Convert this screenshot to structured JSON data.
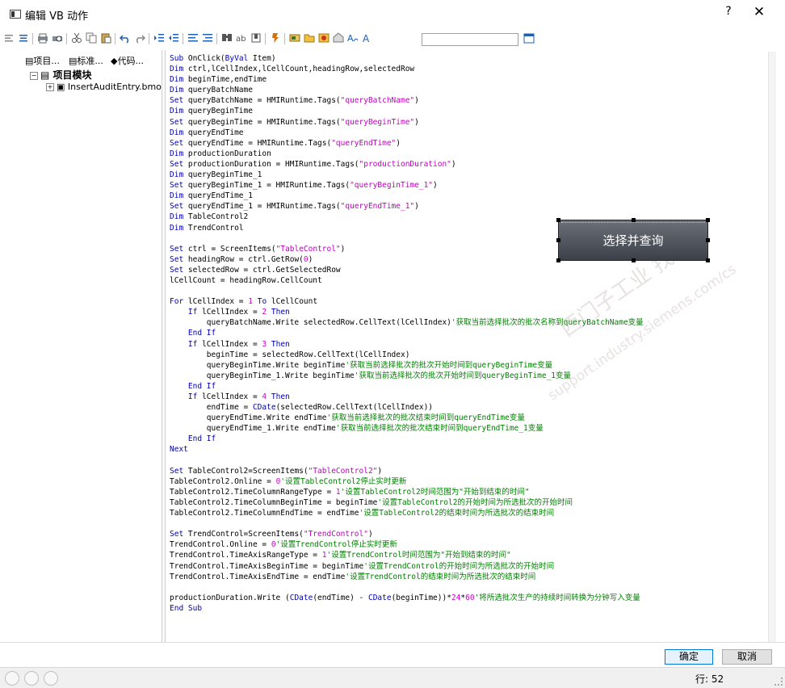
{
  "window": {
    "title": "编辑 VB 动作",
    "help_label": "?",
    "close_label": "✕"
  },
  "toolbar": {
    "icons": [
      "align-left-icon",
      "align-center-icon",
      "print-icon",
      "print-preview-icon",
      "cut-icon",
      "copy-icon",
      "paste-icon",
      "undo-icon",
      "redo-icon",
      "indent-icon",
      "outdent-icon",
      "comment-icon",
      "uncomment-icon",
      "find-icon",
      "replace-icon",
      "bookmark-icon",
      "compile-icon",
      "tag-icon",
      "folder-icon",
      "add-icon",
      "image-icon",
      "font-color-icon",
      "font-icon",
      "calendar-icon"
    ],
    "search_value": ""
  },
  "left_panel": {
    "tabs": [
      "项目...",
      "标准...",
      "代码..."
    ],
    "tree": {
      "root": "项目模块",
      "child": "InsertAuditEntry.bmo"
    }
  },
  "editor": {
    "code": "Sub OnClick(ByVal Item)\nDim ctrl,lCellIndex,lCellCount,headingRow,selectedRow\nDim beginTime,endTime\nDim queryBatchName\nSet queryBatchName = HMIRuntime.Tags(\"queryBatchName\")\nDim queryBeginTime\nSet queryBeginTime = HMIRuntime.Tags(\"queryBeginTime\")\nDim queryEndTime\nSet queryEndTime = HMIRuntime.Tags(\"queryEndTime\")\nDim productionDuration\nSet productionDuration = HMIRuntime.Tags(\"productionDuration\")\nDim queryBeginTime_1\nSet queryBeginTime_1 = HMIRuntime.Tags(\"queryBeginTime_1\")\nDim queryEndTime_1\nSet queryEndTime_1 = HMIRuntime.Tags(\"queryEndTime_1\")\nDim TableControl2\nDim TrendControl\n\nSet ctrl = ScreenItems(\"TableControl\")\nSet headingRow = ctrl.GetRow(0)\nSet selectedRow = ctrl.GetSelectedRow\nlCellCount = headingRow.CellCount\n\nFor lCellIndex = 1 To lCellCount\n    If lCellIndex = 2 Then\n        queryBatchName.Write selectedRow.CellText(lCellIndex)'获取当前选择批次的批次名称到queryBatchName变量\n    End If\n    If lCellIndex = 3 Then\n        beginTime = selectedRow.CellText(lCellIndex)\n        queryBeginTime.Write beginTime'获取当前选择批次的批次开始时间到queryBeginTime变量\n        queryBeginTime_1.Write beginTime'获取当前选择批次的批次开始时间到queryBeginTime_1变量\n    End If\n    If lCellIndex = 4 Then\n        endTime = CDate(selectedRow.CellText(lCellIndex))\n        queryEndTime.Write endTime'获取当前选择批次的批次结束时间到queryEndTime变量\n        queryEndTime_1.Write endTime'获取当前选择批次的批次结束时间到queryEndTime_1变量\n    End If\nNext\n\nSet TableControl2=ScreenItems(\"TableControl2\")\nTableControl2.Online = 0'设置TableControl2停止实时更新\nTableControl2.TimeColumnRangeType = 1'设置TableControl2时间范围为\"开始到结束的时间\"\nTableControl2.TimeColumnBeginTime = beginTime'设置TableControl2的开始时间为所选批次的开始时间\nTableControl2.TimeColumnEndTime = endTime'设置TableControl2的结束时间为所选批次的结束时间\n\nSet TrendControl=ScreenItems(\"TrendControl\")\nTrendControl.Online = 0'设置TrendControl停止实时更新\nTrendControl.TimeAxisRangeType = 1'设置TrendControl时间范围为\"开始到结束的时间\"\nTrendControl.TimeAxisBeginTime = beginTime'设置TrendControl的开始时间为所选批次的开始时间\nTrendControl.TimeAxisEndTime = endTime'设置TrendControl的结束时间为所选批次的结束时间\n\nproductionDuration.Write (CDate(endTime) - CDate(beginTime))*24*60'将所选批次生产的持续时间转换为分钟写入变量\nEnd Sub",
    "overlay_button_label": "选择并查询",
    "watermark_cn": "西门子工业 找答案",
    "watermark_url": "support.industry.siemens.com/cs"
  },
  "footer": {
    "ok_label": "确定",
    "cancel_label": "取消",
    "row_label": "行: 52"
  },
  "colors": {
    "keyword": "#0000b0",
    "string": "#c000c0",
    "number": "#d000d0",
    "comment": "#008000"
  }
}
